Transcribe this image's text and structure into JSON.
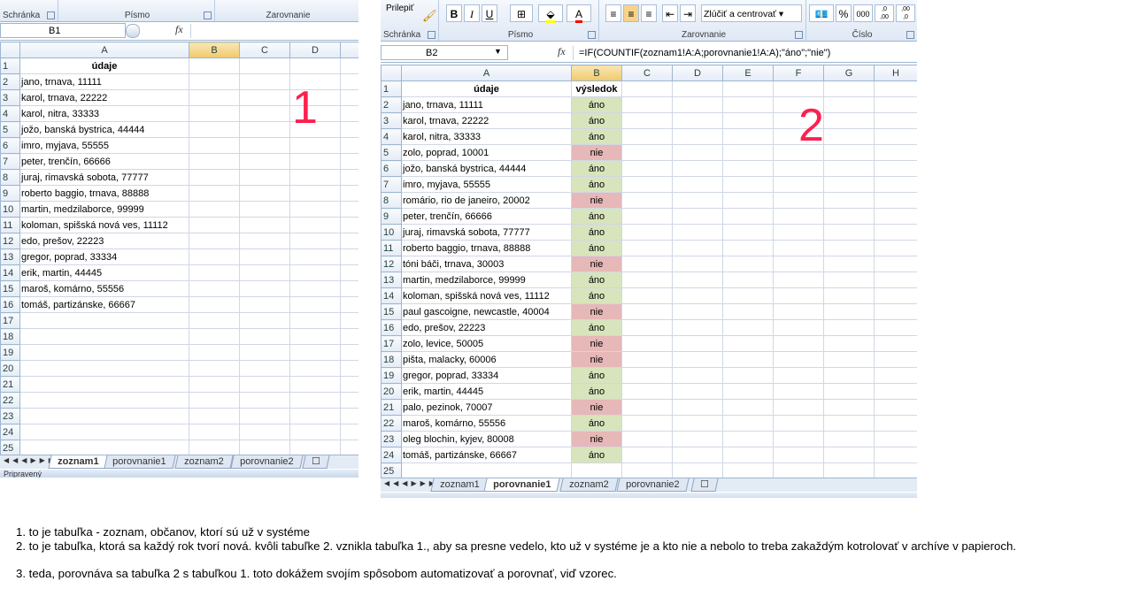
{
  "left": {
    "ribbon": {
      "clipboard_label": "Schránka",
      "font_label": "Písmo",
      "align_label": "Zarovnanie"
    },
    "name_box": "B1",
    "fx": "fx",
    "columns": [
      "A",
      "B",
      "C",
      "D"
    ],
    "rows": [
      {
        "n": "1",
        "a": "údaje"
      },
      {
        "n": "2",
        "a": "jano, trnava, 11111"
      },
      {
        "n": "3",
        "a": "karol, trnava, 22222"
      },
      {
        "n": "4",
        "a": "karol, nitra, 33333"
      },
      {
        "n": "5",
        "a": "jožo, banská bystrica, 44444"
      },
      {
        "n": "6",
        "a": "imro, myjava, 55555"
      },
      {
        "n": "7",
        "a": "peter, trenčín, 66666"
      },
      {
        "n": "8",
        "a": "juraj, rimavská sobota, 77777"
      },
      {
        "n": "9",
        "a": "roberto baggio, trnava, 88888"
      },
      {
        "n": "10",
        "a": "martin, medzilaborce, 99999"
      },
      {
        "n": "11",
        "a": "koloman, spišská nová ves, 11112"
      },
      {
        "n": "12",
        "a": "edo, prešov, 22223"
      },
      {
        "n": "13",
        "a": "gregor, poprad, 33334"
      },
      {
        "n": "14",
        "a": "erik, martin, 44445"
      },
      {
        "n": "15",
        "a": "maroš, komárno, 55556"
      },
      {
        "n": "16",
        "a": "tomáš, partizánske, 66667"
      },
      {
        "n": "17",
        "a": ""
      },
      {
        "n": "18",
        "a": ""
      },
      {
        "n": "19",
        "a": ""
      },
      {
        "n": "20",
        "a": ""
      },
      {
        "n": "21",
        "a": ""
      },
      {
        "n": "22",
        "a": ""
      },
      {
        "n": "23",
        "a": ""
      },
      {
        "n": "24",
        "a": ""
      },
      {
        "n": "25",
        "a": ""
      }
    ],
    "tabs": [
      "zoznam1",
      "porovnanie1",
      "zoznam2",
      "porovnanie2"
    ],
    "status": "Pripravený",
    "big_number": "1"
  },
  "right": {
    "ribbon": {
      "paste_label": "Prilepiť",
      "clipboard_label": "Schránka",
      "font_label": "Písmo",
      "align_label": "Zarovnanie",
      "number_label": "Číslo",
      "bold": "B",
      "italic": "I",
      "underline": "U",
      "font_color": "A",
      "merge_label": "Zlúčiť a centrovať",
      "percent": "%",
      "thousands": "000",
      "inc_dec": ",0 ,00",
      "dec_dec": ",00 ,0"
    },
    "name_box": "B2",
    "fx": "fx",
    "formula": "=IF(COUNTIF(zoznam1!A:A;porovnanie1!A:A);\"áno\";\"nie\")",
    "columns": [
      "A",
      "B",
      "C",
      "D",
      "E",
      "F",
      "G",
      "H"
    ],
    "rows": [
      {
        "n": "1",
        "a": "údaje",
        "b": "výsledok"
      },
      {
        "n": "2",
        "a": "jano, trnava, 11111",
        "b": "áno"
      },
      {
        "n": "3",
        "a": "karol, trnava, 22222",
        "b": "áno"
      },
      {
        "n": "4",
        "a": "karol, nitra, 33333",
        "b": "áno"
      },
      {
        "n": "5",
        "a": "zolo, poprad, 10001",
        "b": "nie"
      },
      {
        "n": "6",
        "a": "jožo, banská bystrica, 44444",
        "b": "áno"
      },
      {
        "n": "7",
        "a": "imro, myjava, 55555",
        "b": "áno"
      },
      {
        "n": "8",
        "a": "romário, rio de janeiro, 20002",
        "b": "nie"
      },
      {
        "n": "9",
        "a": "peter, trenčín, 66666",
        "b": "áno"
      },
      {
        "n": "10",
        "a": "juraj, rimavská sobota, 77777",
        "b": "áno"
      },
      {
        "n": "11",
        "a": "roberto baggio, trnava, 88888",
        "b": "áno"
      },
      {
        "n": "12",
        "a": "tóni báči, trnava, 30003",
        "b": "nie"
      },
      {
        "n": "13",
        "a": "martin, medzilaborce, 99999",
        "b": "áno"
      },
      {
        "n": "14",
        "a": "koloman, spišská nová ves, 11112",
        "b": "áno"
      },
      {
        "n": "15",
        "a": "paul gascoigne, newcastle, 40004",
        "b": "nie"
      },
      {
        "n": "16",
        "a": "edo, prešov, 22223",
        "b": "áno"
      },
      {
        "n": "17",
        "a": "zolo, levice, 50005",
        "b": "nie"
      },
      {
        "n": "18",
        "a": "pišta, malacky, 60006",
        "b": "nie"
      },
      {
        "n": "19",
        "a": "gregor, poprad, 33334",
        "b": "áno"
      },
      {
        "n": "20",
        "a": "erik, martin, 44445",
        "b": "áno"
      },
      {
        "n": "21",
        "a": "palo, pezinok, 70007",
        "b": "nie"
      },
      {
        "n": "22",
        "a": "maroš, komárno, 55556",
        "b": "áno"
      },
      {
        "n": "23",
        "a": "oleg blochin, kyjev, 80008",
        "b": "nie"
      },
      {
        "n": "24",
        "a": "tomáš, partizánske, 66667",
        "b": "áno"
      },
      {
        "n": "25",
        "a": "",
        "b": ""
      }
    ],
    "tabs": [
      "zoznam1",
      "porovnanie1",
      "zoznam2",
      "porovnanie2"
    ],
    "big_number": "2"
  },
  "notes": [
    "1. to je tabuľka - zoznam, občanov, ktorí sú už v systéme",
    "2. to je tabuľka, ktorá sa každý rok tvorí nová. kvôli tabuľke 2. vznikla tabuľka 1., aby sa presne vedelo, kto už v systéme je a kto nie a nebolo to treba zakaždým kotrolovať v archíve v papieroch.",
    "3. teda, porovnáva sa tabuľka 2 s tabuľkou 1. toto dokážem svojím spôsobom automatizovať a porovnať, viď vzorec."
  ],
  "colors": {
    "ano_fill": "#d8e4bc",
    "nie_fill": "#e6b8b7",
    "big_number": "#ff1f4e"
  }
}
